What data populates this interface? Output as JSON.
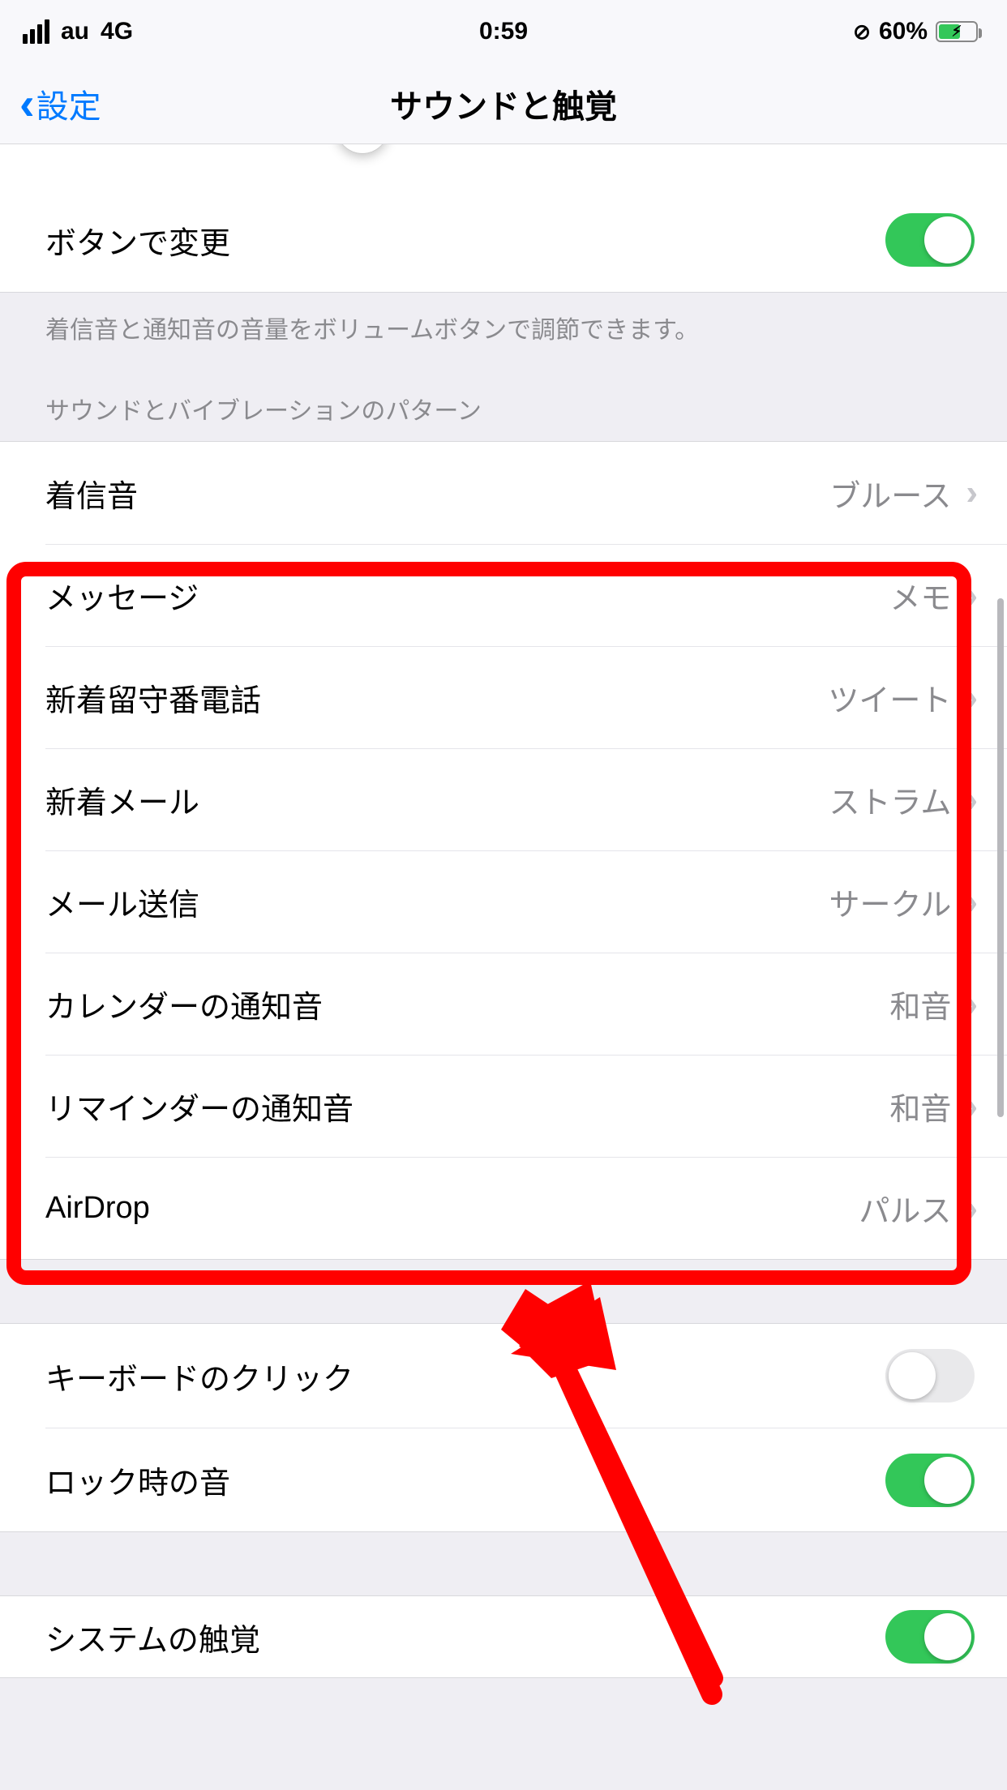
{
  "status": {
    "carrier": "au",
    "network": "4G",
    "time": "0:59",
    "battery_pct": "60%"
  },
  "nav": {
    "back_label": "設定",
    "title": "サウンドと触覚"
  },
  "volume": {
    "toggle_label": "ボタンで変更",
    "toggle_on": true,
    "footer": "着信音と通知音の音量をボリュームボタンで調節できます。"
  },
  "sound_patterns": {
    "header": "サウンドとバイブレーションのパターン",
    "rows": [
      {
        "label": "着信音",
        "value": "ブルース"
      },
      {
        "label": "メッセージ",
        "value": "メモ"
      },
      {
        "label": "新着留守番電話",
        "value": "ツイート"
      },
      {
        "label": "新着メール",
        "value": "ストラム"
      },
      {
        "label": "メール送信",
        "value": "サークル"
      },
      {
        "label": "カレンダーの通知音",
        "value": "和音"
      },
      {
        "label": "リマインダーの通知音",
        "value": "和音"
      },
      {
        "label": "AirDrop",
        "value": "パルス"
      }
    ]
  },
  "other_toggles": [
    {
      "label": "キーボードのクリック",
      "on": false
    },
    {
      "label": "ロック時の音",
      "on": true
    },
    {
      "label": "システムの触覚",
      "on": true
    }
  ],
  "colors": {
    "accent": "#007aff",
    "toggle_on": "#33c759",
    "annotation": "#ff0000"
  }
}
